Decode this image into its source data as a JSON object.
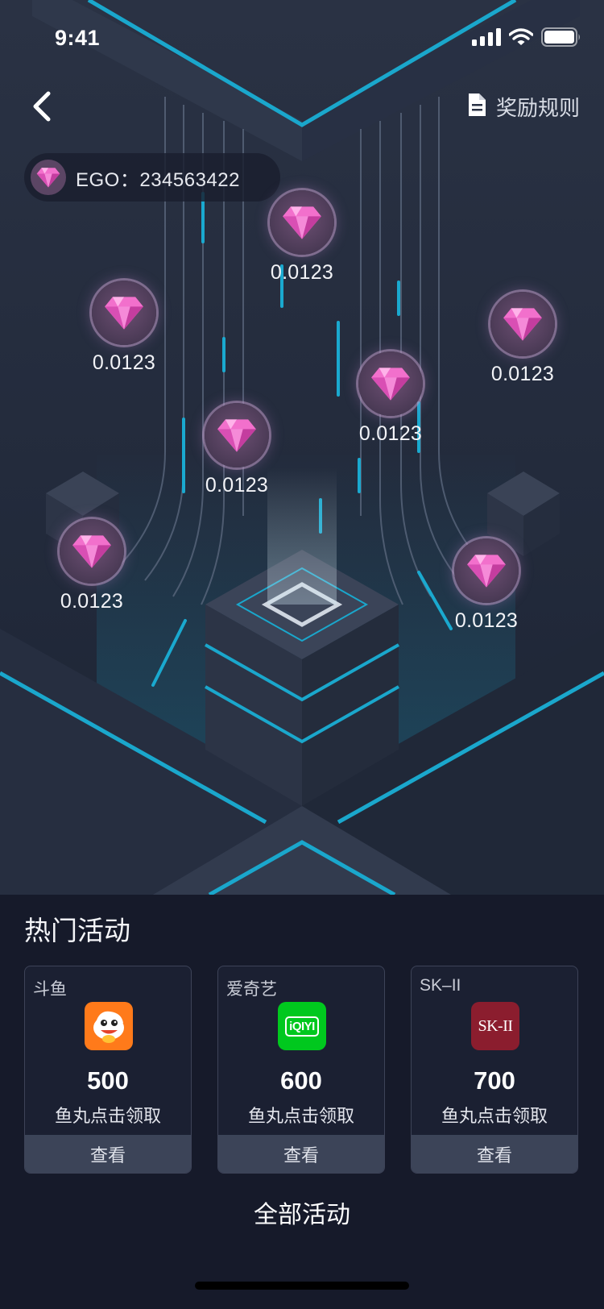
{
  "status_bar": {
    "time": "9:41",
    "icons": [
      "signal-icon",
      "wifi-icon",
      "battery-icon"
    ]
  },
  "header": {
    "back_icon": "chevron-left-icon",
    "rules_icon": "document-icon",
    "rules_label": "奖励规则"
  },
  "balance": {
    "icon": "gem-icon",
    "text": "EGO：234563422"
  },
  "gems": [
    {
      "amount": "0.0123"
    },
    {
      "amount": "0.0123"
    },
    {
      "amount": "0.0123"
    },
    {
      "amount": "0.0123"
    },
    {
      "amount": "0.0123"
    },
    {
      "amount": "0.0123"
    },
    {
      "amount": "0.0123"
    }
  ],
  "activities": {
    "title": "热门活动",
    "cards": [
      {
        "brand": "斗鱼",
        "logo": "douyu-logo",
        "amount": "500",
        "desc": "鱼丸点击领取",
        "action": "查看"
      },
      {
        "brand": "爱奇艺",
        "logo": "iqiyi-logo",
        "amount": "600",
        "desc": "鱼丸点击领取",
        "action": "查看",
        "logo_text": "iQIYI"
      },
      {
        "brand": "SK–II",
        "logo": "sk2-logo",
        "amount": "700",
        "desc": "鱼丸点击领取",
        "action": "查看",
        "logo_text": "SK-II"
      }
    ],
    "all_label": "全部活动"
  },
  "colors": {
    "accent_cyan": "#19a6c9",
    "background": "#16192a",
    "card_button": "#3c4458",
    "gem_pink": "#f06ac8"
  }
}
